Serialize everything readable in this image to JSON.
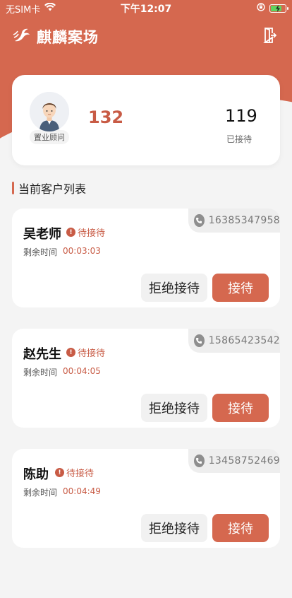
{
  "status_bar": {
    "carrier": "无SIM卡",
    "time": "下午12:07"
  },
  "app_bar": {
    "title": "麒麟案场",
    "logo_icon": "kylin-logo-icon",
    "logout_icon": "logout-door-icon"
  },
  "profile": {
    "role_label": "置业顾问",
    "pending_count": "132",
    "served_count": "119",
    "served_label": "已接待"
  },
  "section": {
    "title": "当前客户列表"
  },
  "customers": [
    {
      "name": "吴老师",
      "status": "待接待",
      "phone": "16385347958",
      "time_label": "剩余时间",
      "time_left": "00:03:03",
      "reject_label": "拒绝接待",
      "accept_label": "接待"
    },
    {
      "name": "赵先生",
      "status": "待接待",
      "phone": "15865423542",
      "time_label": "剩余时间",
      "time_left": "00:04:05",
      "reject_label": "拒绝接待",
      "accept_label": "接待"
    },
    {
      "name": "陈助",
      "status": "待接待",
      "phone": "13458752469",
      "time_label": "剩余时间",
      "time_left": "00:04:49",
      "reject_label": "拒绝接待",
      "accept_label": "接待"
    }
  ],
  "colors": {
    "brand": "#d5684f",
    "accent_text": "#c85b45",
    "background": "#f4f4f4"
  }
}
